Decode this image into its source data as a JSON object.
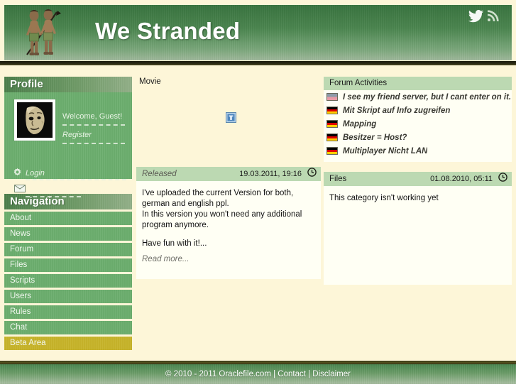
{
  "header": {
    "site_title": "We Stranded",
    "logo_alt": "tribal-warriors-logo",
    "social": [
      {
        "name": "twitter-icon",
        "label": "Twitter"
      },
      {
        "name": "rss-icon",
        "label": "RSS"
      }
    ]
  },
  "sidebar": {
    "profile": {
      "heading": "Profile",
      "welcome": "Welcome, Guest!",
      "register": "Register",
      "login": "Login",
      "avatar_alt": "user-avatar-face"
    },
    "navigation": {
      "heading": "Navigation",
      "items": [
        {
          "label": "About",
          "highlight": false
        },
        {
          "label": "News",
          "highlight": false
        },
        {
          "label": "Forum",
          "highlight": false
        },
        {
          "label": "Files",
          "highlight": false
        },
        {
          "label": "Scripts",
          "highlight": false
        },
        {
          "label": "Users",
          "highlight": false
        },
        {
          "label": "Rules",
          "highlight": false
        },
        {
          "label": "Chat",
          "highlight": false
        },
        {
          "label": "Beta Area",
          "highlight": true
        }
      ]
    }
  },
  "center": {
    "movie_label": "Movie",
    "movie_placeholder_alt": "broken-image-placeholder",
    "article": {
      "title": "Released",
      "date": "19.03.2011, 19:16",
      "paragraphs": [
        "I've uploaded the current Version for both, german and english ppl.\nIn this version you won't need any additional program anymore.",
        "Have fun with it!..."
      ],
      "read_more": "Read more..."
    }
  },
  "right": {
    "forum": {
      "heading": "Forum Activities",
      "items": [
        {
          "flag": "uk",
          "title": "I see my friend server, but I cant enter on it."
        },
        {
          "flag": "de",
          "title": "Mit Skript auf Info zugreifen"
        },
        {
          "flag": "de",
          "title": "Mapping"
        },
        {
          "flag": "de",
          "title": "Besitzer = Host?"
        },
        {
          "flag": "de",
          "title": "Multiplayer Nicht LAN"
        }
      ]
    },
    "article": {
      "title": "Files",
      "date": "01.08.2010, 05:11",
      "body": "This category isn't working yet"
    }
  },
  "footer": {
    "text": "© 2010 - 2011 Oraclefile.com | Contact | Disclaimer"
  },
  "colors": {
    "page_bg": "#fdf6d8",
    "panel_bg": "#fffff4",
    "nav_green": "#6cae6e",
    "nav_highlight": "#c7b42a",
    "header_green": "#4f8a53",
    "article_head": "#bcd9b2"
  }
}
